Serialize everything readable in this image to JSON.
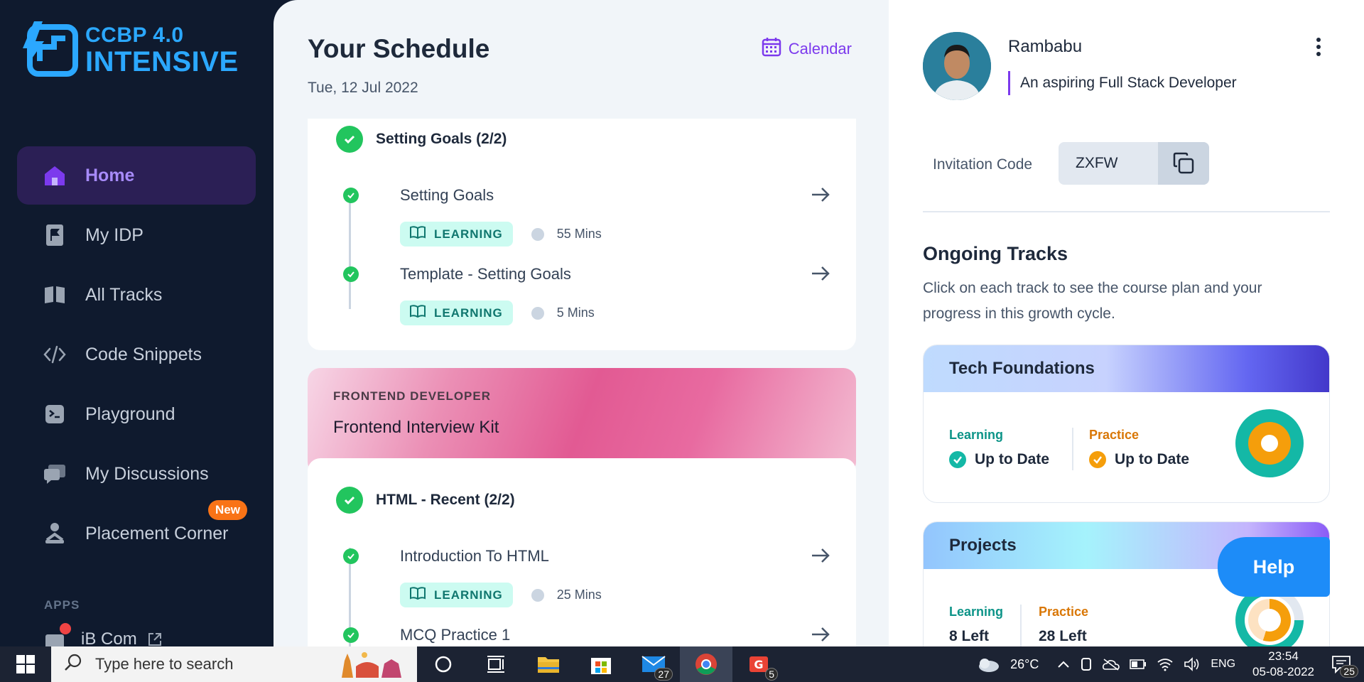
{
  "brand": {
    "line1": "CCBP 4.0",
    "line2": "INTENSIVE"
  },
  "sidebar": {
    "items": [
      {
        "label": "Home",
        "icon": "home-icon",
        "active": true
      },
      {
        "label": "My IDP",
        "icon": "flag-document-icon"
      },
      {
        "label": "All Tracks",
        "icon": "book-icon"
      },
      {
        "label": "Code Snippets",
        "icon": "code-icon"
      },
      {
        "label": "Playground",
        "icon": "terminal-icon"
      },
      {
        "label": "My Discussions",
        "icon": "chat-icon"
      },
      {
        "label": "Placement Corner",
        "icon": "person-laptop-icon",
        "badge": "New"
      }
    ],
    "apps_label": "APPS",
    "app_item": "iB Com"
  },
  "schedule": {
    "title": "Your Schedule",
    "date": "Tue, 12 Jul 2022",
    "calendar_label": "Calendar",
    "group1": {
      "title": "Setting Goals (2/2)",
      "items": [
        {
          "title": "Setting Goals",
          "tag": "LEARNING",
          "duration": "55 Mins"
        },
        {
          "title": "Template - Setting Goals",
          "tag": "LEARNING",
          "duration": "5 Mins"
        }
      ]
    },
    "banner": {
      "category": "FRONTEND DEVELOPER",
      "title": "Frontend Interview Kit"
    },
    "group2": {
      "title": "HTML - Recent (2/2)",
      "items": [
        {
          "title": "Introduction To HTML",
          "tag": "LEARNING",
          "duration": "25 Mins"
        },
        {
          "title": "MCQ Practice 1"
        }
      ]
    }
  },
  "profile": {
    "name": "Rambabu",
    "tagline": "An aspiring Full Stack Developer",
    "invitation_label": "Invitation Code",
    "invitation_code": "ZXFW"
  },
  "ongoing": {
    "title": "Ongoing Tracks",
    "description": "Click on each track to see the course plan and your progress in this growth cycle.",
    "tracks": [
      {
        "name": "Tech Foundations",
        "learning_label": "Learning",
        "learning_value": "Up to Date",
        "practice_label": "Practice",
        "practice_value": "Up to Date"
      },
      {
        "name": "Projects",
        "learning_label": "Learning",
        "learning_value": "8 Left",
        "practice_label": "Practice",
        "practice_value": "28 Left"
      }
    ]
  },
  "help_label": "Help",
  "taskbar": {
    "search_placeholder": "Type here to search",
    "mail_badge": "27",
    "gmail_badge": "5",
    "weather": "26°C",
    "language": "ENG",
    "time": "23:54",
    "date": "05-08-2022",
    "notifications": "25"
  },
  "colors": {
    "accent": "#7c3aed",
    "learning": "#14b8a6",
    "practice": "#f59e0b",
    "success": "#22c55e"
  }
}
